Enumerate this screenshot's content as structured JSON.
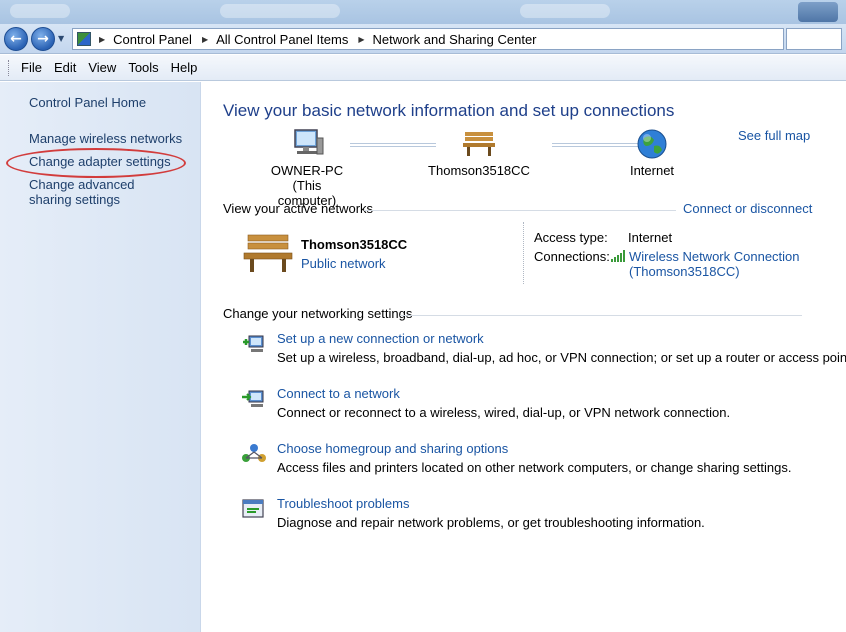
{
  "breadcrumb": [
    "Control Panel",
    "All Control Panel Items",
    "Network and Sharing Center"
  ],
  "menu": [
    "File",
    "Edit",
    "View",
    "Tools",
    "Help"
  ],
  "left_pane": {
    "home": "Control Panel Home",
    "links": [
      "Manage wireless networks",
      "Change adapter settings",
      "Change advanced sharing settings"
    ]
  },
  "main": {
    "heading": "View your basic network information and set up connections",
    "see_full_map": "See full map",
    "map": {
      "computer_name": "OWNER-PC",
      "computer_sub": "(This computer)",
      "router": "Thomson3518CC",
      "internet": "Internet"
    },
    "active_networks": {
      "label": "View your active networks",
      "connect_link": "Connect or disconnect",
      "network_name": "Thomson3518CC",
      "network_type": "Public network",
      "access_type_label": "Access type:",
      "access_type_value": "Internet",
      "connections_label": "Connections:",
      "connection_line1": "Wireless Network Connection",
      "connection_line2": "(Thomson3518CC)"
    },
    "settings_label": "Change your networking settings",
    "tasks": [
      {
        "link": "Set up a new connection or network",
        "desc": "Set up a wireless, broadband, dial-up, ad hoc, or VPN connection; or set up a router or access point."
      },
      {
        "link": "Connect to a network",
        "desc": "Connect or reconnect to a wireless, wired, dial-up, or VPN network connection."
      },
      {
        "link": "Choose homegroup and sharing options",
        "desc": "Access files and printers located on other network computers, or change sharing settings."
      },
      {
        "link": "Troubleshoot problems",
        "desc": "Diagnose and repair network problems, or get troubleshooting information."
      }
    ]
  },
  "colors": {
    "link": "#1a55a3",
    "heading": "#1e3f8a",
    "annotation_circle": "#d23c3c"
  }
}
